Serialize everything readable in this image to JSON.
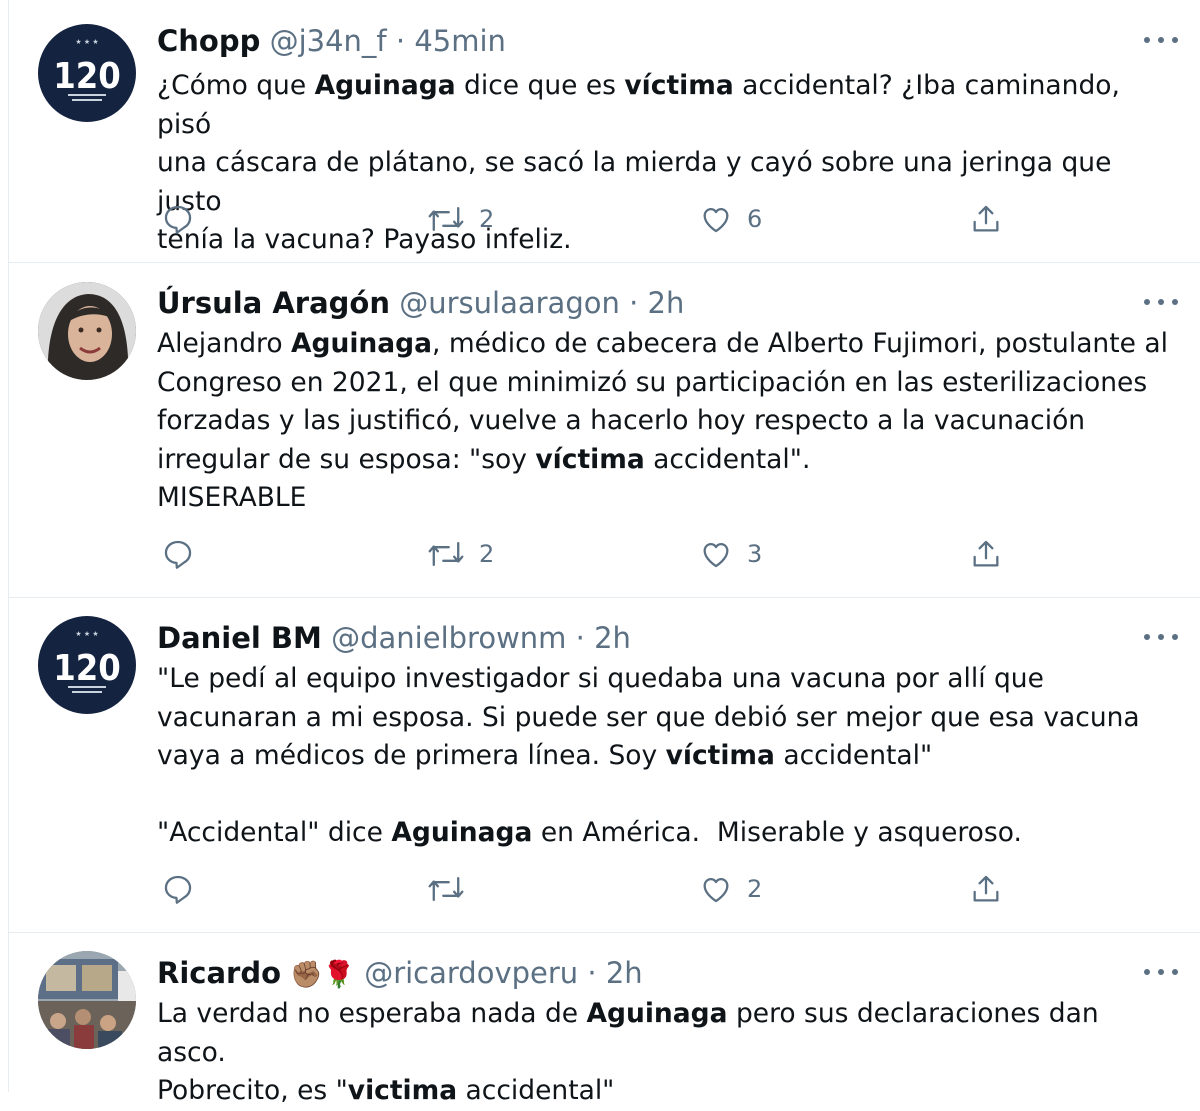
{
  "tweets": [
    {
      "name": "Chopp",
      "handle": "@j34n_f",
      "separator": "·",
      "time": "45min",
      "avatar": "team-logo-120",
      "segments": [
        {
          "t": "¿Cómo que ",
          "b": false
        },
        {
          "t": "Aguinaga",
          "b": true
        },
        {
          "t": " dice que es ",
          "b": false
        },
        {
          "t": "víctima",
          "b": true
        },
        {
          "t": " accidental? ¿Iba caminando, pisó\nuna cáscara de plátano, se sacó la mierda y cayó sobre una jeringa que justo\ntenía la vacuna? Payaso infeliz.",
          "b": false
        }
      ],
      "retweets": "2",
      "likes": "6"
    },
    {
      "name": "Úrsula Aragón",
      "handle": "@ursulaaragon",
      "separator": "·",
      "time": "2h",
      "avatar": "profile-photo",
      "segments": [
        {
          "t": "Alejandro ",
          "b": false
        },
        {
          "t": "Aguinaga",
          "b": true
        },
        {
          "t": ", médico de cabecera de Alberto Fujimori, postulante al\nCongreso en 2021, el que minimizó su participación en las esterilizaciones\nforzadas y las justificó, vuelve a hacerlo hoy respecto a la vacunación\nirregular de su esposa: \"soy ",
          "b": false
        },
        {
          "t": "víctima",
          "b": true
        },
        {
          "t": " accidental\".\nMISERABLE",
          "b": false
        }
      ],
      "retweets": "2",
      "likes": "3"
    },
    {
      "name": "Daniel BM",
      "handle": "@danielbrownm",
      "separator": "·",
      "time": "2h",
      "avatar": "team-logo-120",
      "segments": [
        {
          "t": "\"Le pedí al equipo investigador si quedaba una vacuna por allí que\nvacunaran a mi esposa. Si puede ser que debió ser mejor que esa vacuna\nvaya a médicos de primera línea. Soy ",
          "b": false
        },
        {
          "t": "víctima",
          "b": true
        },
        {
          "t": " accidental\"\n\n\"Accidental\" dice ",
          "b": false
        },
        {
          "t": "Aguinaga",
          "b": true
        },
        {
          "t": " en América.  Miserable y asqueroso.",
          "b": false
        }
      ],
      "retweets": "",
      "likes": "2"
    },
    {
      "name": "Ricardo",
      "emojis": "✊🏽🌹",
      "handle": "@ricardovperu",
      "separator": "·",
      "time": "2h",
      "avatar": "crowd-photo",
      "segments": [
        {
          "t": "La verdad no esperaba nada de ",
          "b": false
        },
        {
          "t": "Aguinaga",
          "b": true
        },
        {
          "t": " pero sus declaraciones dan asco.\nPobrecito, es \"",
          "b": false
        },
        {
          "t": "victima",
          "b": true
        },
        {
          "t": " accidental\"",
          "b": false
        }
      ],
      "retweets": "",
      "likes": ""
    }
  ],
  "logo_text": "120",
  "icons": [
    "reply-icon",
    "retweet-icon",
    "like-icon",
    "share-icon",
    "more-icon"
  ],
  "colors": {
    "secondary_text": "#5b7083",
    "logo_bg": "#14233f",
    "divider": "#e6ecf0"
  }
}
